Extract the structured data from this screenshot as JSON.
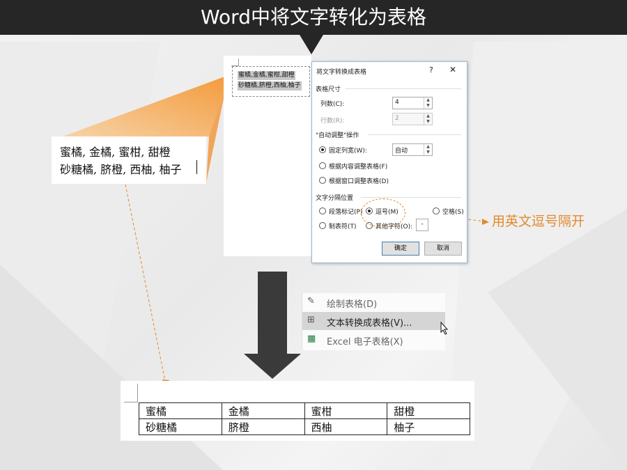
{
  "header": {
    "title": "Word中将文字转化为表格"
  },
  "document": {
    "selected_lines": [
      "蜜橘,金橘,蜜柑,甜橙",
      "砂糖橘,脐橙,西柚,柚子"
    ]
  },
  "zoom": {
    "lines": [
      "蜜橘, 金橘, 蜜柑, 甜橙",
      "砂糖橘, 脐橙, 西柚, 柚子"
    ]
  },
  "dialog": {
    "title": "将文字转换成表格",
    "help": "?",
    "close": "✕",
    "table_size": {
      "section_label": "表格尺寸",
      "columns_label": "列数(C):",
      "columns_value": "4",
      "rows_label": "行数(R):",
      "rows_value": "2"
    },
    "autofit": {
      "section_label": "\"自动调整\"操作",
      "fixed_width_label": "固定列宽(W):",
      "fixed_width_value": "自动",
      "fit_contents_label": "根据内容调整表格(F)",
      "fit_window_label": "根据窗口调整表格(D)"
    },
    "separator": {
      "section_label": "文字分隔位置",
      "paragraph_label": "段落标记(P)",
      "comma_label": "逗号(M)",
      "space_label": "空格(S)",
      "tab_label": "制表符(T)",
      "other_label": "其他字符(O):",
      "other_value": "-",
      "selected": "comma"
    },
    "ok_label": "确定",
    "cancel_label": "取消"
  },
  "annotation": {
    "text": "用英文逗号隔开",
    "color": "#e28a2e"
  },
  "menu": {
    "items": [
      {
        "label": "绘制表格(D)",
        "icon": "pencil-table-icon",
        "highlighted": false
      },
      {
        "label": "文本转换成表格(V)...",
        "icon": "text-to-table-icon",
        "highlighted": true
      },
      {
        "label": "Excel 电子表格(X)",
        "icon": "excel-table-icon",
        "highlighted": false
      }
    ]
  },
  "result_table": {
    "rows": [
      [
        "蜜橘",
        "金橘",
        "蜜柑",
        "甜橙"
      ],
      [
        "砂糖橘",
        "脐橙",
        "西柚",
        "柚子"
      ]
    ]
  },
  "colors": {
    "header_bg": "#262626",
    "accent_orange": "#e28a2e",
    "arrow": "#3a3a3a"
  }
}
